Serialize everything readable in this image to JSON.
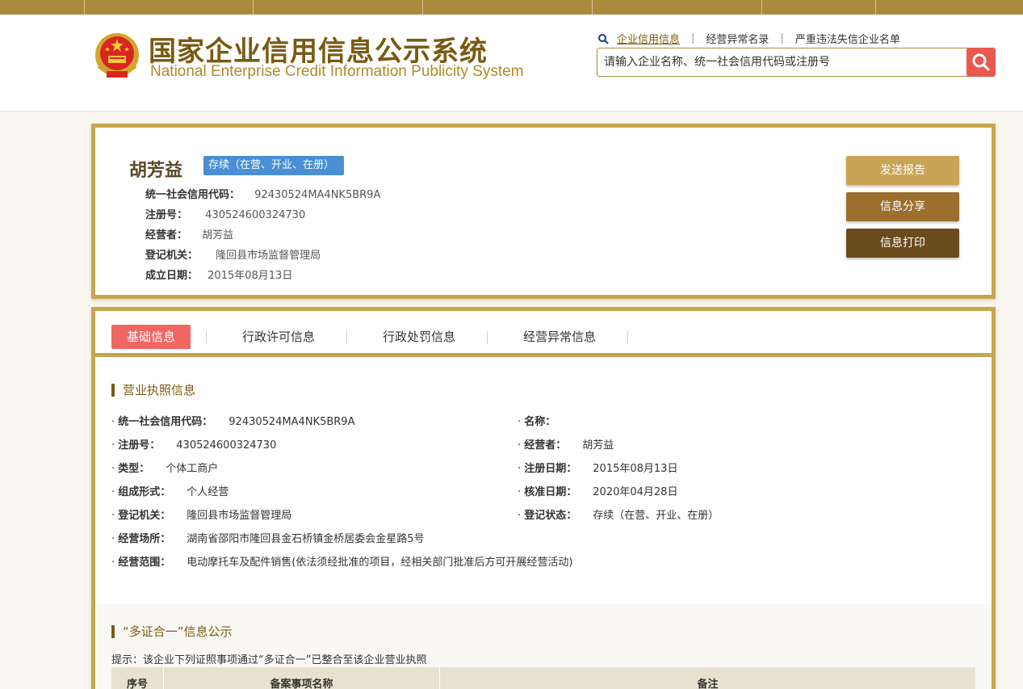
{
  "header": {
    "title_cn": "国家企业信用信息公示系统",
    "title_en": "National Enterprise Credit Information Publicity System",
    "links": [
      "企业信用信息",
      "经营异常名录",
      "严重违法失信企业名单"
    ],
    "search_placeholder": "请输入企业名称、统一社会信用代码或注册号"
  },
  "company": {
    "name": "胡芳益",
    "status": "存续（在营、开业、在册）",
    "rows": [
      {
        "label": "统一社会信用代码：",
        "value": "92430524MA4NK5BR9A"
      },
      {
        "label": "注册号：",
        "value": "430524600324730"
      },
      {
        "label": "经营者：",
        "value": "胡芳益"
      },
      {
        "label": "登记机关：",
        "value": "隆回县市场监督管理局"
      },
      {
        "label": "成立日期：",
        "value": "2015年08月13日"
      }
    ]
  },
  "actions": {
    "send_report": "发送报告",
    "share": "信息分享",
    "print": "信息打印"
  },
  "colors": {
    "gold": "#c8a64e",
    "brown_light": "#c9a456",
    "brown_mid": "#9c6f2e",
    "brown_dark": "#6b4b1c",
    "tab_active": "#f06663",
    "badge": "#4a8fd4"
  },
  "tabs": [
    "基础信息",
    "行政许可信息",
    "行政处罚信息",
    "经营异常信息"
  ],
  "license": {
    "title": "营业执照信息",
    "left": [
      {
        "label": "统一社会信用代码：",
        "value": "92430524MA4NK5BR9A"
      },
      {
        "label": "注册号：",
        "value": "430524600324730"
      },
      {
        "label": "类型：",
        "value": "个体工商户"
      },
      {
        "label": "组成形式：",
        "value": "个人经营"
      },
      {
        "label": "登记机关：",
        "value": "隆回县市场监督管理局"
      },
      {
        "label": "经营场所：",
        "value": "湖南省邵阳市隆回县金石桥镇金桥居委会金星路5号"
      },
      {
        "label": "经营范围：",
        "value": "电动摩托车及配件销售(依法须经批准的项目，经相关部门批准后方可开展经营活动)"
      }
    ],
    "right": [
      {
        "label": "名称：",
        "value": ""
      },
      {
        "label": "经营者：",
        "value": "胡芳益"
      },
      {
        "label": "注册日期：",
        "value": "2015年08月13日"
      },
      {
        "label": "核准日期：",
        "value": "2020年04月28日"
      },
      {
        "label": "登记状态：",
        "value": "存续（在营、开业、在册）"
      }
    ]
  },
  "multi_cert": {
    "title": "“多证合一”信息公示",
    "hint": "提示：该企业下列证照事项通过“多证合一”已整合至该企业营业执照",
    "columns": [
      "序号",
      "备案事项名称",
      "备注"
    ]
  }
}
